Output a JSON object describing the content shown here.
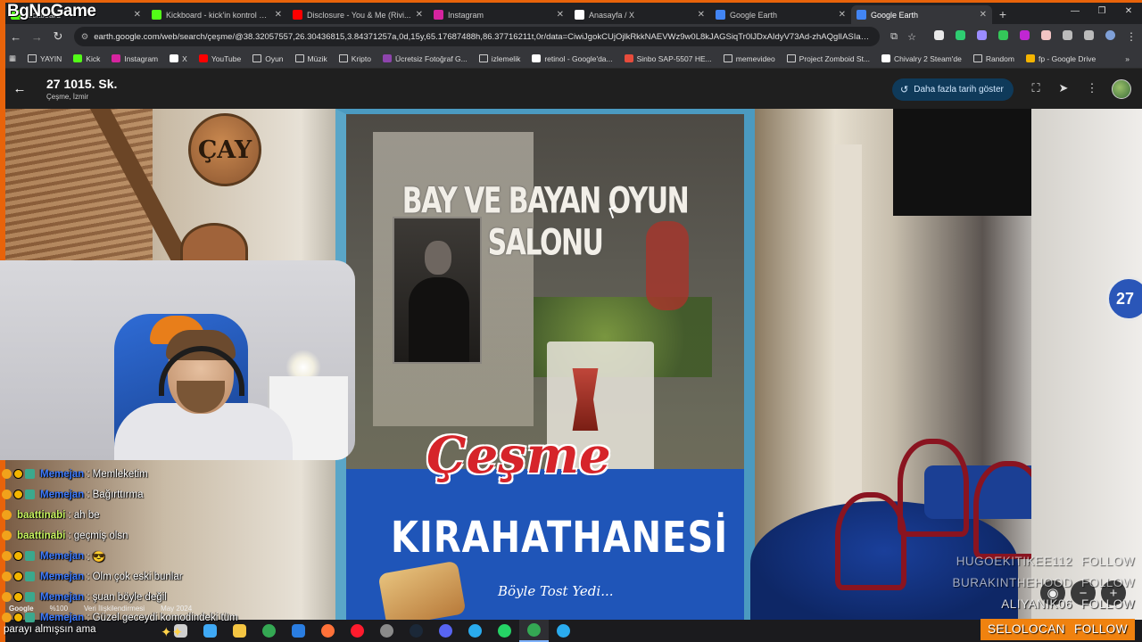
{
  "overlay": {
    "logo_text": "BgNoGame"
  },
  "browser": {
    "tabs": [
      {
        "title": "Kickboard",
        "favicon_color": "#53fc18",
        "active": false
      },
      {
        "title": "Kickboard - kick'in kontrol paneli",
        "favicon_color": "#53fc18",
        "active": false
      },
      {
        "title": "Disclosure - You & Me (Rivi...",
        "favicon_color": "#ff0000",
        "active": false
      },
      {
        "title": "Instagram",
        "favicon_color": "#d6249f",
        "active": false
      },
      {
        "title": "Anasayfa / X",
        "favicon_color": "#ffffff",
        "active": false
      },
      {
        "title": "Google Earth",
        "favicon_color": "#4285f4",
        "active": false
      },
      {
        "title": "Google Earth",
        "favicon_color": "#4285f4",
        "active": true
      }
    ],
    "new_tab": "+",
    "url": "earth.google.com/web/search/çeşme/@38.32057557,26.30436815,3.84371257a,0d,15y,65.17687488h,86.37716211t,0r/data=CiwiJgokCUjOjlkRkkNAEVWz9w0L8kJAGSiqTr0lJDxAIdyV73Ad-zhAQglIASIaChZVbVZ...",
    "bookmarks": [
      {
        "label": "YAYIN",
        "type": "folder",
        "color": "#cfcfcf"
      },
      {
        "label": "Kick",
        "type": "site",
        "color": "#53fc18"
      },
      {
        "label": "Instagram",
        "type": "site",
        "color": "#d6249f"
      },
      {
        "label": "X",
        "type": "site",
        "color": "#ffffff"
      },
      {
        "label": "YouTube",
        "type": "site",
        "color": "#ff0000"
      },
      {
        "label": "Oyun",
        "type": "folder",
        "color": "#cfcfcf"
      },
      {
        "label": "Müzik",
        "type": "folder",
        "color": "#cfcfcf"
      },
      {
        "label": "Kripto",
        "type": "folder",
        "color": "#cfcfcf"
      },
      {
        "label": "Ücretsiz Fotoğraf G...",
        "type": "site",
        "color": "#8e44ad"
      },
      {
        "label": "izlemelik",
        "type": "folder",
        "color": "#cfcfcf"
      },
      {
        "label": "retinol - Google'da...",
        "type": "site",
        "color": "#ffffff"
      },
      {
        "label": "Sinbo SAP-5507 HE...",
        "type": "site",
        "color": "#e74c3c"
      },
      {
        "label": "memevideo",
        "type": "folder",
        "color": "#cfcfcf"
      },
      {
        "label": "Project Zomboid St...",
        "type": "folder",
        "color": "#cfcfcf"
      },
      {
        "label": "Chivalry 2 Steam'de",
        "type": "site",
        "color": "#ffffff"
      },
      {
        "label": "Random",
        "type": "folder",
        "color": "#cfcfcf"
      },
      {
        "label": "fp - Google Drive",
        "type": "site",
        "color": "#f4b400"
      }
    ],
    "bookmarks_more": "»"
  },
  "earth": {
    "street": "27 1015. Sk.",
    "city": "Çeşme, İzmir",
    "date_button": "Daha fazla tarih göster",
    "house_number": "27",
    "attribution": {
      "brand": "Google",
      "zoom": "%100",
      "credit": "Veri İlişkilendirmesi",
      "date": "May 2024"
    }
  },
  "scene_text": {
    "cay_sign": "ÇAY",
    "window_title": "BAY VE BAYAN OYUN SALONU",
    "banner_brand": "Çeşme",
    "banner_name": "KIRAHATHANESİ",
    "banner_tagline": "Böyle Tost Yedi..."
  },
  "chat": [
    {
      "user": "Memejan",
      "message": ": Memleketim",
      "user_color": "#3f7cff",
      "badges": true
    },
    {
      "user": "Memejan",
      "message": ": Bağırttırma",
      "user_color": "#3f7cff",
      "badges": true
    },
    {
      "user": "baattinabi",
      "message": ": ah be",
      "user_color": "#c9f560",
      "badges": false
    },
    {
      "user": "baattinabi",
      "message": ": geçmiş olsn",
      "user_color": "#c9f560",
      "badges": false
    },
    {
      "user": "Memejan",
      "message": ": 😎",
      "user_color": "#3f7cff",
      "badges": true
    },
    {
      "user": "Memejan",
      "message": ": Olm çok eski bunlar",
      "user_color": "#3f7cff",
      "badges": true
    },
    {
      "user": "Memejan",
      "message": ": şuan böyle değil",
      "user_color": "#3f7cff",
      "badges": true
    },
    {
      "user": "Memejan",
      "message": ": Güzel geceydi komodindeki tüm",
      "user_color": "#3f7cff",
      "badges": true
    }
  ],
  "chat_continuation": "parayı almışsın ama",
  "follows": [
    {
      "name": "HUGOEKITIKEE112",
      "action": "FOLLOW",
      "style": "dim"
    },
    {
      "name": "BURAKINTHEHOOD",
      "action": "FOLLOW",
      "style": "dim"
    },
    {
      "name": "ALIYANIK06",
      "action": "FOLLOW",
      "style": "normal"
    },
    {
      "name": "SELOLOCAN",
      "action": "FOLLOW",
      "style": "highlight"
    }
  ],
  "taskbar_apps": [
    {
      "name": "task-view",
      "color": "#cfcfcf"
    },
    {
      "name": "copilot",
      "color": "#3fa9f5"
    },
    {
      "name": "file-explorer",
      "color": "#f4c542"
    },
    {
      "name": "chrome",
      "color": "#34a853"
    },
    {
      "name": "mail",
      "color": "#2a7de1"
    },
    {
      "name": "firefox",
      "color": "#ff7139"
    },
    {
      "name": "opera",
      "color": "#ff1b2d"
    },
    {
      "name": "obs",
      "color": "#8a8a8a"
    },
    {
      "name": "steam",
      "color": "#1b2838"
    },
    {
      "name": "discord",
      "color": "#5865f2"
    },
    {
      "name": "telegram",
      "color": "#2aabee"
    },
    {
      "name": "whatsapp",
      "color": "#25d366"
    },
    {
      "name": "chrome-active",
      "color": "#34a853"
    },
    {
      "name": "telegram-2",
      "color": "#2aabee"
    }
  ]
}
